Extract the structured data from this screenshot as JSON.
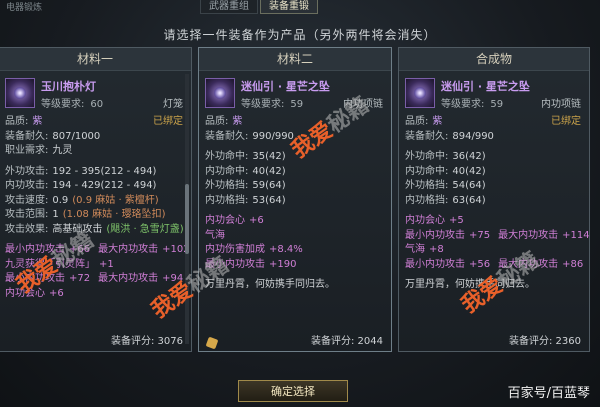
{
  "top": {
    "corner_label": "电器锻炼",
    "tabs": [
      {
        "label": "武器重组",
        "active": false
      },
      {
        "label": "装备重锻",
        "active": true
      }
    ],
    "instruction": "请选择一件装备作为产品（另外两件将会消失）"
  },
  "panels": [
    {
      "header": "材料一",
      "item": {
        "name": "玉川抱朴灯",
        "req_label": "等级要求:",
        "req_value": "60",
        "type": "灯笼"
      },
      "rows": [
        {
          "l": "品质:",
          "lv": "紫",
          "r": "已绑定"
        },
        {
          "l": "装备耐久:",
          "lv": "807/1000"
        },
        {
          "l": "职业需求:",
          "lv": "九灵"
        },
        {
          "sep": true
        },
        {
          "l": "外功攻击:",
          "lv": "192 - 395(212 - 494)"
        },
        {
          "l": "内功攻击:",
          "lv": "194 - 429(212 - 494)"
        },
        {
          "l": "攻击速度:",
          "lv": "0.9",
          "extra": "(0.9 麻姑 · 紫檀杆)"
        },
        {
          "l": "攻击范围:",
          "lv": "1",
          "extra": "(1.08 麻姑 · 璎珞坠扣)"
        },
        {
          "l": "攻击效果:",
          "lv": "高基础攻击",
          "extra2": "(飓洪 · 急雪灯盏)"
        },
        {
          "sep": true
        },
        {
          "l": "最小内功攻击",
          "lv": "+66",
          "l2": "最大内功攻击",
          "lv2": "+102"
        },
        {
          "l": "九灵获得「引灵阵」",
          "lv": "+1"
        },
        {
          "l": "最小内功攻击",
          "lv": "+72",
          "l2": "最大内功攻击",
          "lv2": "+94"
        },
        {
          "l": "内功会心",
          "lv": "+6"
        }
      ],
      "score": "装备评分: 3076"
    },
    {
      "header": "材料二",
      "item": {
        "name": "迷仙引 · 星芒之坠",
        "req_label": "等级要求:",
        "req_value": "59",
        "type": "内功项链"
      },
      "rows": [
        {
          "l": "品质:",
          "lv": "紫"
        },
        {
          "l": "装备耐久:",
          "lv": "990/990"
        },
        {
          "sep": true
        },
        {
          "l": "外功命中:",
          "lv": "35(42)"
        },
        {
          "l": "内功命中:",
          "lv": "40(42)"
        },
        {
          "l": "外功格挡:",
          "lv": "59(64)"
        },
        {
          "l": "内功格挡:",
          "lv": "53(64)"
        },
        {
          "sep": true
        },
        {
          "l": "内功会心",
          "lv": "+6"
        },
        {
          "l": "气海",
          "lv": ""
        },
        {
          "l": "内功伤害加成",
          "lv": "+8.4%"
        },
        {
          "l": "最小内功攻击",
          "lv": "+190"
        },
        {
          "sep": true
        },
        {
          "desc": "万里丹霄，何妨携手同归去。"
        }
      ],
      "score": "装备评分: 2044"
    },
    {
      "header": "合成物",
      "item": {
        "name": "迷仙引 · 星芒之坠",
        "req_label": "等级要求:",
        "req_value": "59",
        "type": "内功项链"
      },
      "rows": [
        {
          "l": "品质:",
          "lv": "紫",
          "r": "已绑定"
        },
        {
          "l": "装备耐久:",
          "lv": "894/990"
        },
        {
          "sep": true
        },
        {
          "l": "外功命中:",
          "lv": "36(42)"
        },
        {
          "l": "内功命中:",
          "lv": "40(42)"
        },
        {
          "l": "外功格挡:",
          "lv": "54(64)"
        },
        {
          "l": "内功格挡:",
          "lv": "63(64)"
        },
        {
          "sep": true
        },
        {
          "l": "内功会心",
          "lv": "+5"
        },
        {
          "l": "最小内功攻击",
          "lv": "+75",
          "l2": "最大内功攻击",
          "lv2": "+114"
        },
        {
          "l": "气海",
          "lv": "+8"
        },
        {
          "l": "最小内功攻击",
          "lv": "+56",
          "l2": "最大内功攻击",
          "lv2": "+86"
        },
        {
          "sep": true
        },
        {
          "desc": "万里丹霄，何妨携手同归去。"
        }
      ],
      "score": "装备评分: 2360"
    }
  ],
  "confirm_label": "确定选择",
  "source_label": "百家号/百蓝琴",
  "watermark": {
    "a": "我爱",
    "b": "秘籍"
  }
}
